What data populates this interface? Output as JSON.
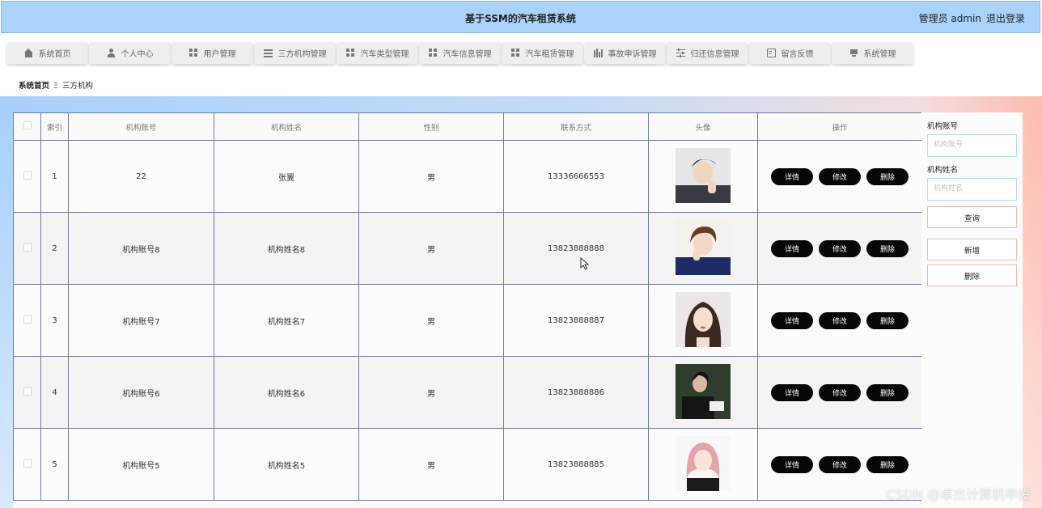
{
  "header": {
    "title": "基于SSM的汽车租赁系统",
    "user_label": "管理员 admin",
    "logout": "退出登录",
    "bg_color": "#a9d3fa"
  },
  "nav": {
    "items": [
      {
        "label": "系统首页",
        "icon": "home-icon"
      },
      {
        "label": "个人中心",
        "icon": "user-icon"
      },
      {
        "label": "用户管理",
        "icon": "grid-icon"
      },
      {
        "label": "三方机构管理",
        "icon": "list-icon"
      },
      {
        "label": "汽车类型管理",
        "icon": "grid-icon"
      },
      {
        "label": "汽车信息管理",
        "icon": "grid-icon"
      },
      {
        "label": "汽车租赁管理",
        "icon": "grid-icon"
      },
      {
        "label": "事故申诉管理",
        "icon": "bar-chart-icon"
      },
      {
        "label": "归还信息管理",
        "icon": "sliders-icon"
      },
      {
        "label": "留言反馈",
        "icon": "document-icon"
      },
      {
        "label": "系统管理",
        "icon": "monitor-icon"
      }
    ]
  },
  "breadcrumb": {
    "home": "系统首页",
    "separator": "Ξ",
    "current": "三方机构"
  },
  "table": {
    "headers": {
      "index": "索引",
      "account": "机构账号",
      "name": "机构姓名",
      "gender": "性别",
      "phone": "联系方式",
      "avatar": "头像",
      "actions": "操作"
    },
    "action_labels": {
      "detail": "详情",
      "edit": "修改",
      "delete": "删除"
    },
    "rows": [
      {
        "index": "1",
        "account": "22",
        "name": "张翼",
        "gender": "男",
        "phone": "13336666553",
        "avatar": "avatar-photo-1"
      },
      {
        "index": "2",
        "account": "机构账号8",
        "name": "机构姓名8",
        "gender": "男",
        "phone": "13823888888",
        "avatar": "avatar-photo-2"
      },
      {
        "index": "3",
        "account": "机构账号7",
        "name": "机构姓名7",
        "gender": "男",
        "phone": "13823888887",
        "avatar": "avatar-photo-3"
      },
      {
        "index": "4",
        "account": "机构账号6",
        "name": "机构姓名6",
        "gender": "男",
        "phone": "13823888886",
        "avatar": "avatar-photo-4"
      },
      {
        "index": "5",
        "account": "机构账号5",
        "name": "机构姓名5",
        "gender": "男",
        "phone": "13823888885",
        "avatar": "avatar-photo-5"
      }
    ]
  },
  "search": {
    "account_label": "机构账号",
    "account_placeholder": "机构账号",
    "account_value": "",
    "name_label": "机构姓名",
    "name_placeholder": "机构姓名",
    "name_value": "",
    "query": "查询",
    "add": "新增",
    "delete": "删除"
  },
  "watermark": "CSDN @卓杰计算机毕设"
}
